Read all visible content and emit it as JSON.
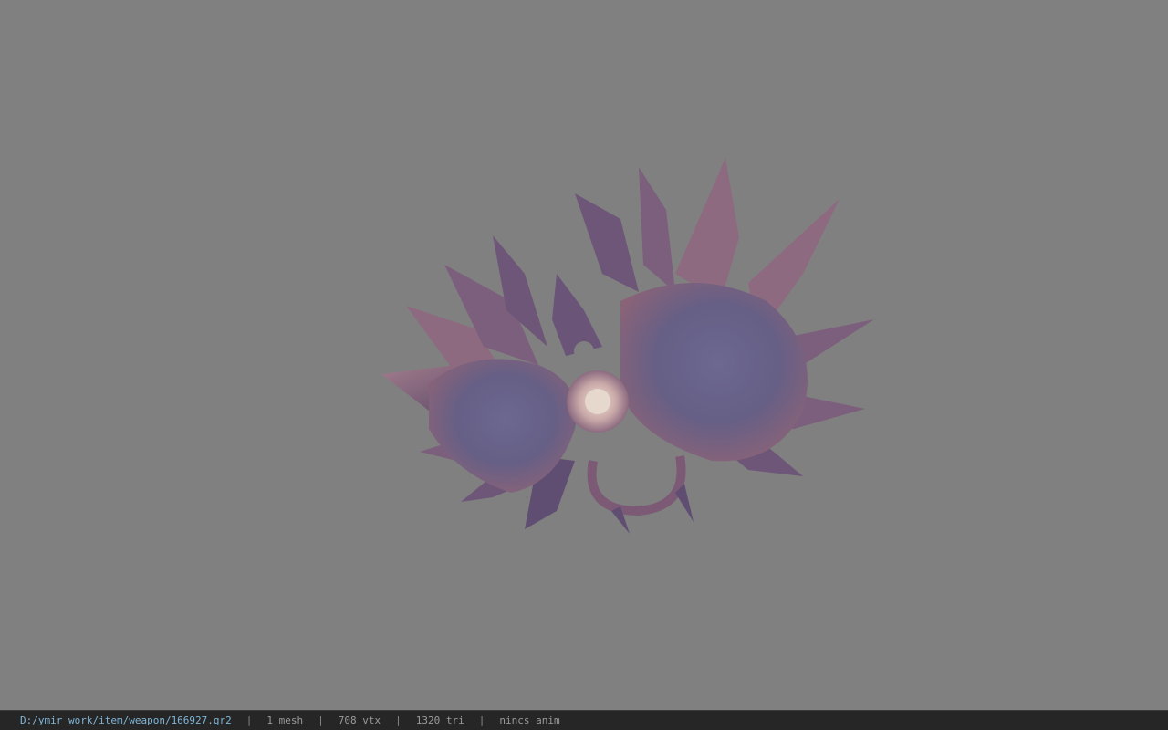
{
  "viewer": {
    "background_color": "#808080",
    "model_icon": "weapon-3d-model"
  },
  "status_bar": {
    "file_path": "D:/ymir work/item/weapon/166927.gr2",
    "separator": "|",
    "mesh_count": "1 mesh",
    "vertex_count": "708 vtx",
    "triangle_count": "1320 tri",
    "anim_status": "nincs anim"
  },
  "colors": {
    "path_text": "#7fb6d8",
    "status_text": "#9a9a9a",
    "status_bg": "#262626",
    "model_purple": "#6e6590",
    "model_pink": "#8c6478",
    "model_center": "#d8c8c0"
  }
}
